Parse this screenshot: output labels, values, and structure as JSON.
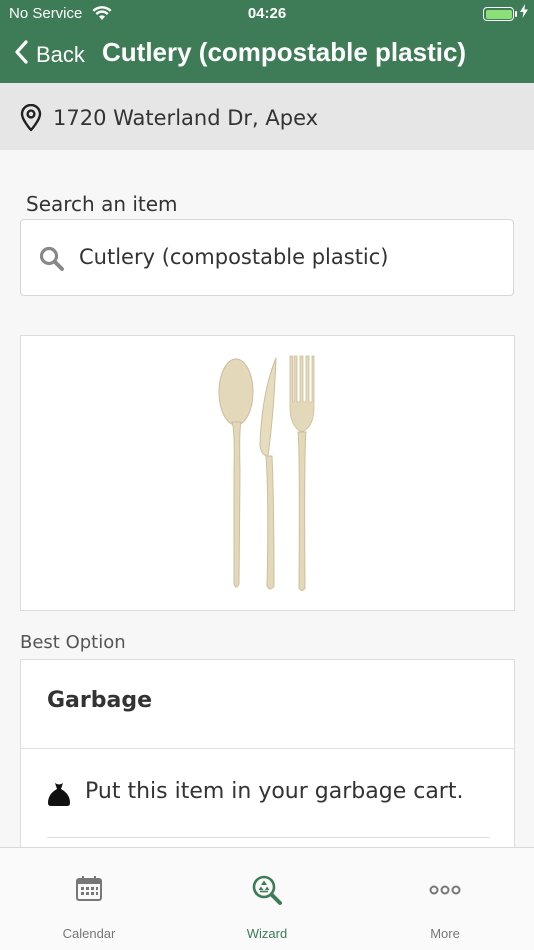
{
  "status_bar": {
    "carrier": "No Service",
    "time": "04:26"
  },
  "nav": {
    "back_label": "Back",
    "title": "Cutlery (compostable plastic)"
  },
  "address": {
    "text": "1720 Waterland Dr, Apex",
    "icon": "location-pin-icon"
  },
  "search": {
    "label": "Search an item",
    "value": "Cutlery (compostable plastic)",
    "icon": "search-icon"
  },
  "item_image": {
    "icon": "cutlery-image"
  },
  "best_option": {
    "section_label": "Best Option",
    "title": "Garbage",
    "instruction": "Put this item in your garbage cart.",
    "icon": "garbage-bag-icon"
  },
  "tabs": [
    {
      "label": "Calendar",
      "icon": "calendar-icon",
      "active": false
    },
    {
      "label": "Wizard",
      "icon": "recycle-search-icon",
      "active": true
    },
    {
      "label": "More",
      "icon": "more-dots-icon",
      "active": false
    }
  ],
  "colors": {
    "brand_green": "#3d7c56",
    "battery_fill": "#8be07a",
    "background": "#f6f7f6"
  }
}
